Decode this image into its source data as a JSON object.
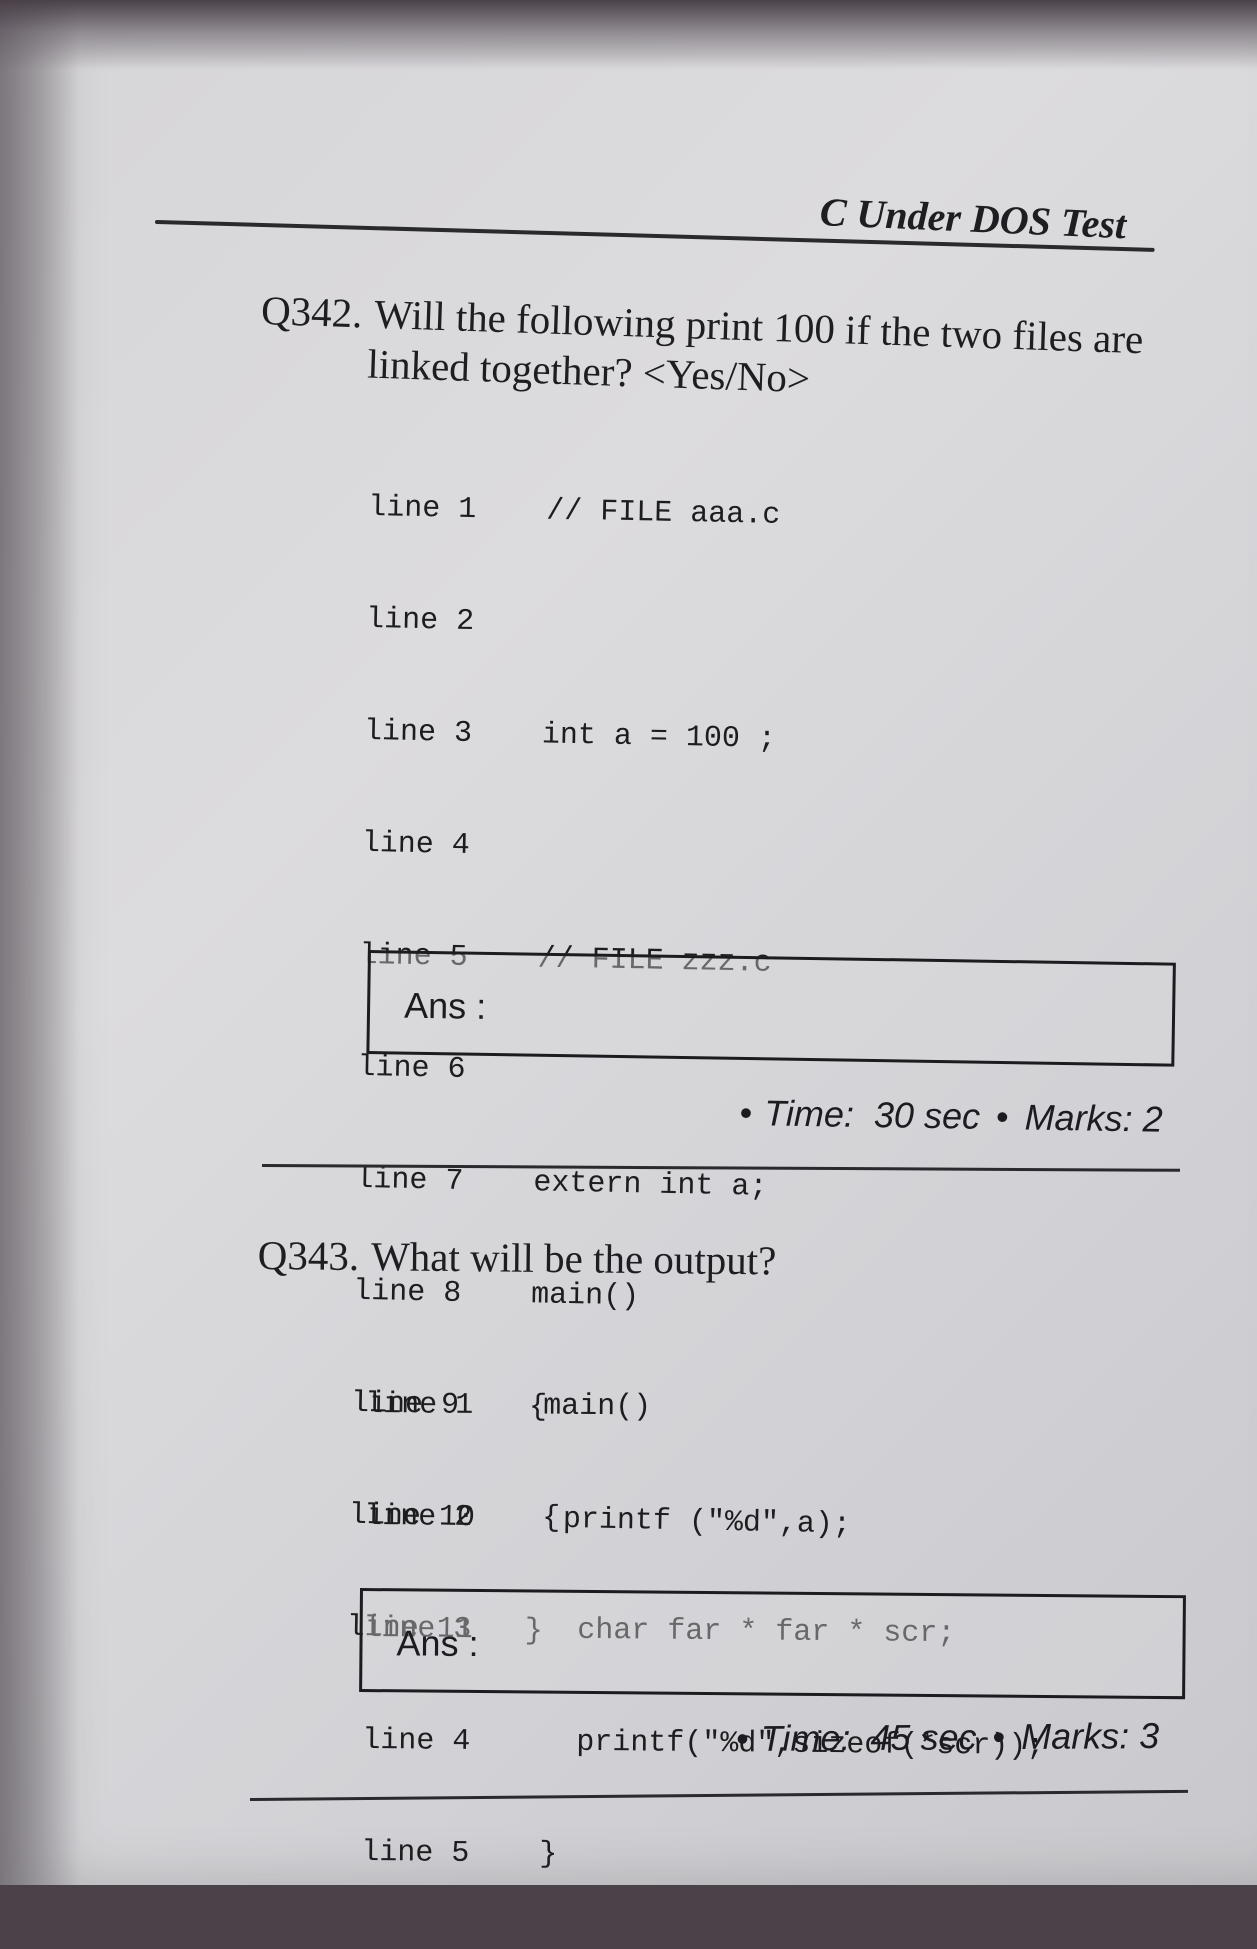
{
  "header": {
    "title": "C Under DOS Test"
  },
  "questions": [
    {
      "number": "Q342.",
      "text_line1": "Will the following print 100 if the two files are",
      "text_line2": "linked together? <Yes/No>",
      "code": [
        {
          "line": "line 1",
          "code": "// FILE aaa.c"
        },
        {
          "line": "line 2",
          "code": ""
        },
        {
          "line": "line 3",
          "code": "int a = 100 ;"
        },
        {
          "line": "line 4",
          "code": ""
        },
        {
          "line": "line 5",
          "code": "// FILE zzz.c"
        },
        {
          "line": "line 6",
          "code": ""
        },
        {
          "line": "line 7",
          "code": "extern int a;"
        },
        {
          "line": "line 8",
          "code": "main()"
        },
        {
          "line": "line 9",
          "code": "{"
        },
        {
          "line": "line 10",
          "code": "  printf (\"%d\",a);"
        },
        {
          "line": "line 11",
          "code": "}"
        }
      ],
      "answer_label": "Ans :",
      "time_label": "Time:",
      "time_value": "30 sec",
      "marks_label": "Marks:",
      "marks_value": "2"
    },
    {
      "number": "Q343.",
      "text_line1": "What will be the output?",
      "code": [
        {
          "line": "line 1",
          "code": "main()"
        },
        {
          "line": "line 2",
          "code": "{"
        },
        {
          "line": "line 3",
          "code": "  char far * far * scr;"
        },
        {
          "line": "line 4",
          "code": "  printf(\"%d\",sizeof(*scr));"
        },
        {
          "line": "line 5",
          "code": "}"
        }
      ],
      "answer_label": "Ans :",
      "time_label": "Time:",
      "time_value": "45 sec",
      "marks_label": "Marks:",
      "marks_value": "3"
    }
  ]
}
